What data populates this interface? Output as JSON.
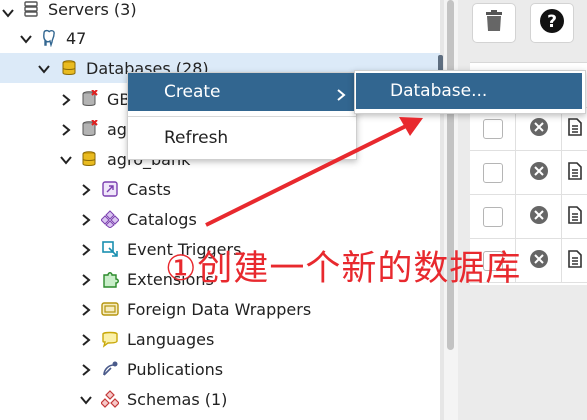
{
  "tree": {
    "servers": "Servers (3)",
    "server_47": "47",
    "databases": "Databases (28)",
    "db1_partial": "GB",
    "db2_partial": "agr",
    "agro_bank": "agro_bank",
    "items": [
      {
        "label": "Casts",
        "icon": "casts-icon"
      },
      {
        "label": "Catalogs",
        "icon": "catalogs-icon"
      },
      {
        "label": "Event Triggers",
        "icon": "event-triggers-icon"
      },
      {
        "label": "Extensions",
        "icon": "extensions-icon"
      },
      {
        "label": "Foreign Data Wrappers",
        "icon": "foreign-data-wrappers-icon"
      },
      {
        "label": "Languages",
        "icon": "languages-icon"
      },
      {
        "label": "Publications",
        "icon": "publications-icon"
      },
      {
        "label": "Schemas (1)",
        "icon": "schemas-icon"
      }
    ]
  },
  "context_menu": {
    "create": "Create",
    "refresh": "Refresh",
    "submenu_database": "Database..."
  },
  "toolbar": {
    "delete_icon": "trash-icon",
    "help_icon": "help-icon"
  },
  "grid_rows": 4,
  "annotation": {
    "text": "①创建一个新的数据库",
    "color": "#e8292e"
  },
  "colors": {
    "menu_highlight": "#326690",
    "selected_row": "#dceaf8"
  }
}
